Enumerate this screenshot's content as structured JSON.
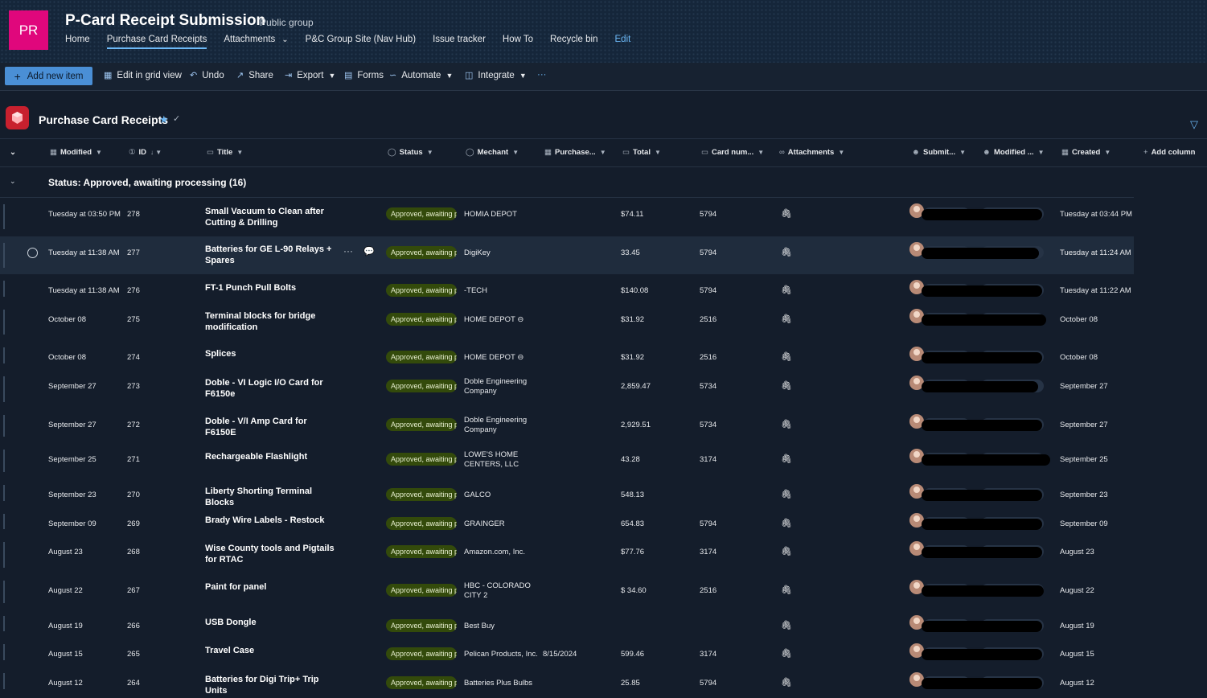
{
  "site": {
    "logo_initials": "PR",
    "title": "P-Card Receipt Submission",
    "group_label": "Public group",
    "nav": [
      "Home",
      "Purchase Card Receipts",
      "Attachments",
      "P&C Group Site (Nav Hub)",
      "Issue tracker",
      "How To",
      "Recycle bin",
      "Edit"
    ],
    "active_nav": "Purchase Card Receipts"
  },
  "commands": {
    "add_new_item": "Add new item",
    "edit_grid": "Edit in grid view",
    "undo": "Undo",
    "share": "Share",
    "export": "Export",
    "forms": "Forms",
    "automate": "Automate",
    "integrate": "Integrate",
    "more": "···"
  },
  "list": {
    "title": "Purchase Card Receipts",
    "columns": [
      "Modified",
      "ID",
      "Title",
      "Status",
      "Mechant",
      "Purchase...",
      "Total",
      "Card num...",
      "Attachments",
      "Submit...",
      "Modified ...",
      "Created",
      "Add column"
    ],
    "group_label": "Status: Approved, awaiting processing (16)",
    "status_text": "Approved, awaiting processing"
  },
  "rows": [
    {
      "modified": "Tuesday at 03:50 PM",
      "id": "278",
      "title": "Small Vacuum to Clean after Cutting & Drilling",
      "merchant": "HOMIA DEPOT",
      "purchase_date": "",
      "total": "$74.11",
      "card": "5794",
      "created": "Tuesday at 03:44 PM"
    },
    {
      "modified": "Tuesday at 11:38 AM",
      "id": "277",
      "title": "Batteries for GE L-90 Relays + Spares",
      "merchant": "DigiKey",
      "purchase_date": "",
      "total": "33.45",
      "card": "5794",
      "created": "Tuesday at 11:24 AM"
    },
    {
      "modified": "Tuesday at 11:38 AM",
      "id": "276",
      "title": "FT-1 Punch Pull Bolts",
      "merchant": "-TECH",
      "purchase_date": "",
      "total": "$140.08",
      "card": "5794",
      "created": "Tuesday at 11:22 AM"
    },
    {
      "modified": "October 08",
      "id": "275",
      "title": "Terminal blocks for bridge modification",
      "merchant": "HOME DEPOT ⊖",
      "purchase_date": "",
      "total": "$31.92",
      "card": "2516",
      "created": "October 08"
    },
    {
      "modified": "October 08",
      "id": "274",
      "title": "Splices",
      "merchant": "HOME DEPOT ⊖",
      "purchase_date": "",
      "total": "$31.92",
      "card": "2516",
      "created": "October 08"
    },
    {
      "modified": "September 27",
      "id": "273",
      "title": "Doble - VI Logic I/O Card for F6150e",
      "merchant": "Doble Engineering Company",
      "purchase_date": "",
      "total": "2,859.47",
      "card": "5734",
      "created": "September 27"
    },
    {
      "modified": "September 27",
      "id": "272",
      "title": "Doble - V/I Amp Card for F6150E",
      "merchant": "Doble Engineering Company",
      "purchase_date": "",
      "total": "2,929.51",
      "card": "5734",
      "created": "September 27"
    },
    {
      "modified": "September 25",
      "id": "271",
      "title": "Rechargeable Flashlight",
      "merchant": "LOWE'S HOME CENTERS, LLC",
      "purchase_date": "",
      "total": "43.28",
      "card": "3174",
      "created": "September 25"
    },
    {
      "modified": "September 23",
      "id": "270",
      "title": "Liberty Shorting Terminal Blocks",
      "merchant": "GALCO",
      "purchase_date": "",
      "total": "548.13",
      "card": "",
      "created": "September 23"
    },
    {
      "modified": "September 09",
      "id": "269",
      "title": "Brady Wire Labels - Restock",
      "merchant": "GRAINGER",
      "purchase_date": "",
      "total": "654.83",
      "card": "5794",
      "created": "September 09"
    },
    {
      "modified": "August 23",
      "id": "268",
      "title": "Wise County tools and Pigtails for RTAC",
      "merchant": "Amazon.com, Inc.",
      "purchase_date": "",
      "total": "$77.76",
      "card": "3174",
      "created": "August 23"
    },
    {
      "modified": "August 22",
      "id": "267",
      "title": "Paint for panel",
      "merchant": "HBC - COLORADO CITY 2",
      "purchase_date": "",
      "total": "$ 34.60",
      "card": "2516",
      "created": "August 22"
    },
    {
      "modified": "August 19",
      "id": "266",
      "title": "USB Dongle",
      "merchant": "Best Buy",
      "purchase_date": "",
      "total": "",
      "card": "",
      "created": "August 19"
    },
    {
      "modified": "August 15",
      "id": "265",
      "title": "Travel Case",
      "merchant": "Pelican Products, Inc.",
      "purchase_date": "8/15/2024",
      "total": "599.46",
      "card": "3174",
      "created": "August 15"
    },
    {
      "modified": "August 12",
      "id": "264",
      "title": "Batteries for Digi Trip+ Trip Units",
      "merchant": "Batteries Plus Bulbs",
      "purchase_date": "",
      "total": "25.85",
      "card": "5794",
      "created": "August 12"
    }
  ]
}
